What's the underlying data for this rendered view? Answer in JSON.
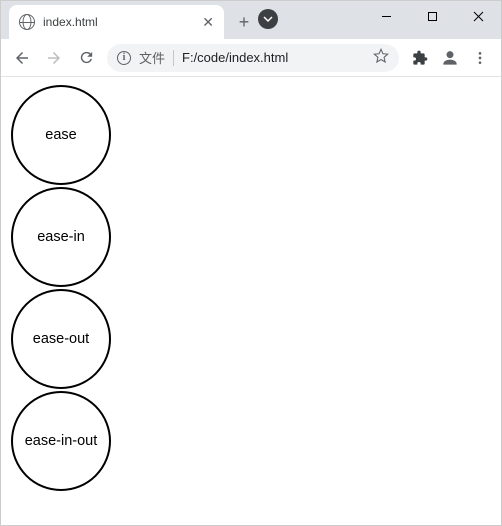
{
  "window": {
    "tab_title": "index.html",
    "minimize": "—",
    "maximize": "☐",
    "close": "✕"
  },
  "addressbar": {
    "prefix": "文件",
    "url": "F:/code/index.html"
  },
  "page": {
    "circles": [
      {
        "label": "ease"
      },
      {
        "label": "ease-in"
      },
      {
        "label": "ease-out"
      },
      {
        "label": "ease-in-out"
      }
    ]
  }
}
